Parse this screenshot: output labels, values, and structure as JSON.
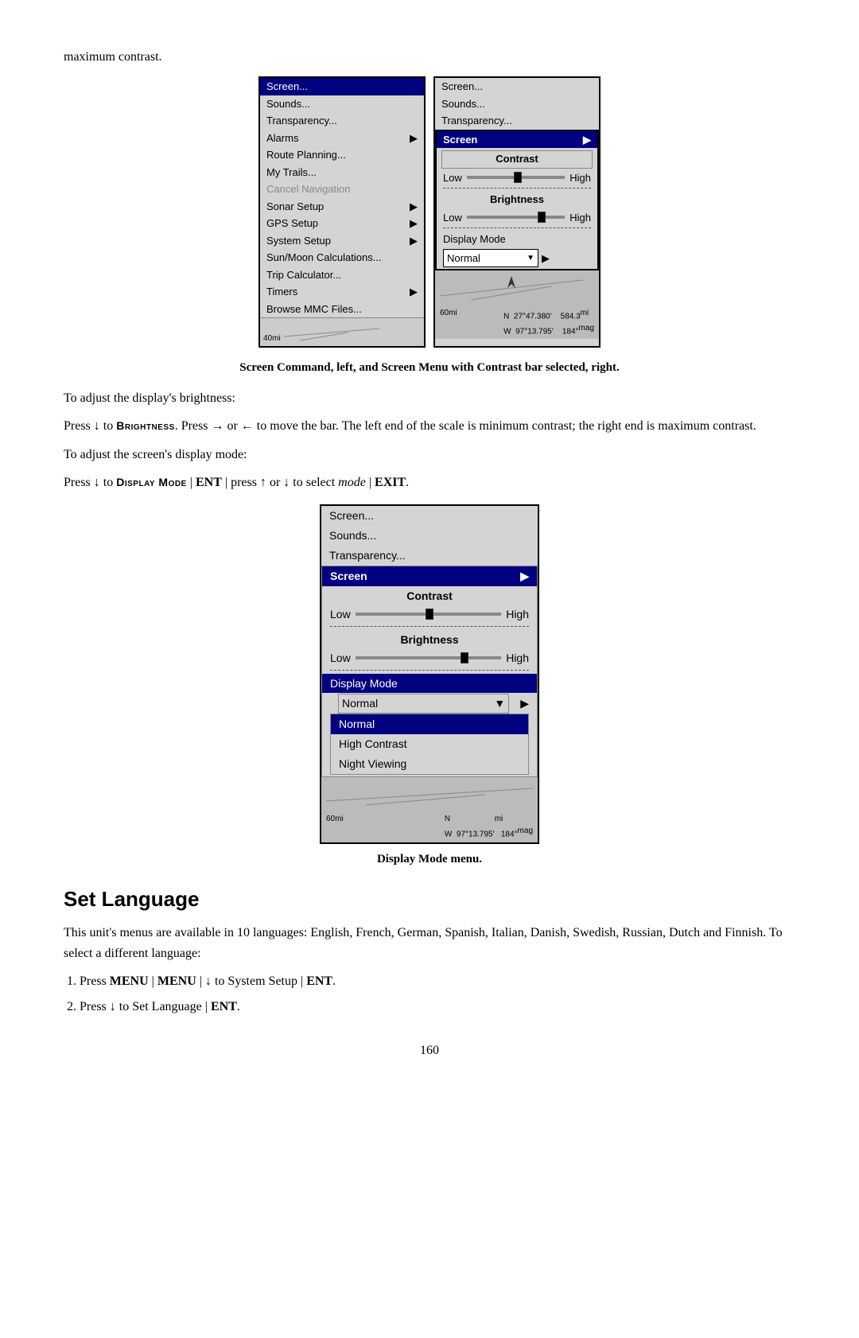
{
  "page": {
    "intro_text": "maximum contrast.",
    "caption_top": "Screen Command, left, and Screen Menu with Contrast bar selected, right.",
    "caption_bottom": "Display Mode menu.",
    "section_heading": "Set Language",
    "section_intro": "This unit's menus are available in 10 languages: English, French, German, Spanish, Italian, Danish, Swedish, Russian, Dutch and Finnish. To select a different language:",
    "page_number": "160"
  },
  "paragraphs": {
    "brightness_intro": "To adjust the display's brightness:",
    "brightness_detail": "Press ↓ to BRIGHTNESS. Press → or ← to move the bar. The left end of the scale is minimum contrast; the right end is maximum contrast.",
    "display_mode_intro": "To adjust the screen's display mode:",
    "display_mode_detail": "Press ↓ to DISPLAY MODE | ENT | press ↑ or ↓ to select mode | EXIT."
  },
  "steps": [
    "Press MENU | MENU | ↓ to SYSTEM SETUP | ENT.",
    "Press ↓ to SET LANGUAGE | ENT."
  ],
  "left_menu": {
    "items": [
      {
        "label": "Screen...",
        "selected": true,
        "arrow": false
      },
      {
        "label": "Sounds...",
        "selected": false,
        "arrow": false
      },
      {
        "label": "Transparency...",
        "selected": false,
        "arrow": false
      },
      {
        "label": "Alarms",
        "selected": false,
        "arrow": true
      },
      {
        "label": "Route Planning...",
        "selected": false,
        "arrow": false
      },
      {
        "label": "My Trails...",
        "selected": false,
        "arrow": false
      },
      {
        "label": "Cancel Navigation",
        "selected": false,
        "arrow": false,
        "greyed": true
      },
      {
        "label": "Sonar Setup",
        "selected": false,
        "arrow": true
      },
      {
        "label": "GPS Setup",
        "selected": false,
        "arrow": true
      },
      {
        "label": "System Setup",
        "selected": false,
        "arrow": true
      },
      {
        "label": "Sun/Moon Calculations...",
        "selected": false,
        "arrow": false
      },
      {
        "label": "Trip Calculator...",
        "selected": false,
        "arrow": false
      },
      {
        "label": "Timers",
        "selected": false,
        "arrow": true
      },
      {
        "label": "Browse MMC Files...",
        "selected": false,
        "arrow": false
      }
    ],
    "footer": "40mi"
  },
  "right_panel_top": {
    "top_items": [
      "Screen...",
      "Sounds...",
      "Transparency..."
    ],
    "submenu_title": "Screen",
    "contrast_label": "Contrast",
    "low": "Low",
    "high": "High",
    "brightness_label": "Brightness",
    "display_mode_label": "Display Mode",
    "display_mode_value": "Normal",
    "coords": {
      "scale": "60mi",
      "n": "27°47.380'",
      "w": "97°13.795'",
      "dist": "584.3",
      "dist_unit": "mi",
      "mag": "184°",
      "mag_unit": "mag"
    }
  },
  "large_panel": {
    "top_items": [
      "Screen...",
      "Sounds...",
      "Transparency..."
    ],
    "submenu_title": "Screen",
    "contrast_label": "Contrast",
    "low": "Low",
    "high": "High",
    "brightness_label": "Brightness",
    "display_mode_label": "Display Mode",
    "display_mode_value": "Normal",
    "dropdown_items": [
      {
        "label": "Normal",
        "selected": true
      },
      {
        "label": "High Contrast",
        "selected": false
      },
      {
        "label": "Night Viewing",
        "selected": false
      }
    ],
    "coords": {
      "scale": "60mi",
      "n": "N",
      "w": "W",
      "coord1": "97°13.795'",
      "dist_unit": "mi",
      "mag": "184°",
      "mag_unit": "mag"
    }
  }
}
